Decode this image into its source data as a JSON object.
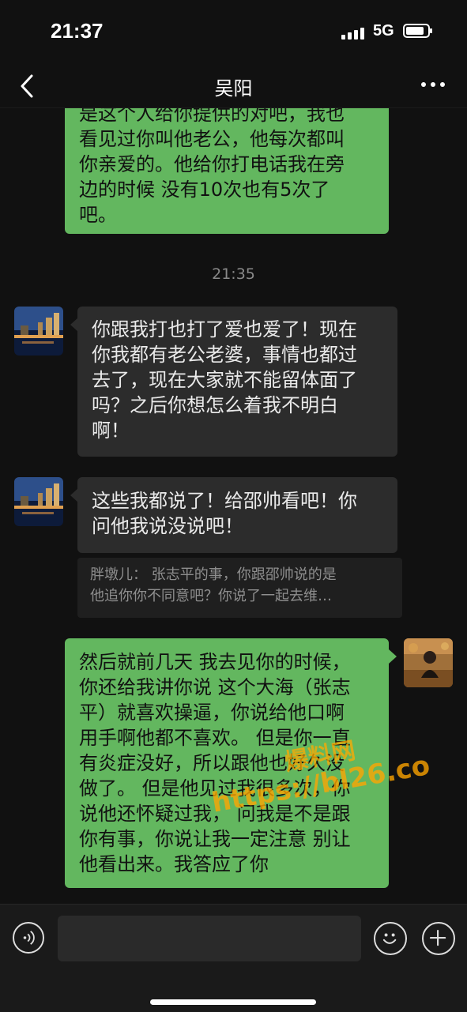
{
  "status_bar": {
    "time": "21:37",
    "network": "5G",
    "icons": [
      "signal-icon",
      "battery-icon"
    ]
  },
  "nav": {
    "title": "吴阳",
    "icons": [
      "back-chevron-icon",
      "more-icon"
    ]
  },
  "messages": [
    {
      "side": "right",
      "lines": [
        "是这个人给你提供的对吧，我也",
        "看见过你叫他老公，他每次都叫",
        "你亲爱的。他给你打电话我在旁",
        "边的时候 没有10次也有5次了",
        "吧。"
      ]
    },
    {
      "timestamp": "21:35"
    },
    {
      "side": "left",
      "lines": [
        "你跟我打也打了爱也爱了！现在",
        "你我都有老公老婆，事情也都过",
        "去了，现在大家就不能留体面了",
        "吗？之后你想怎么着我不明白",
        "啊！"
      ]
    },
    {
      "side": "left",
      "lines": [
        "这些我都说了！给邵帅看吧！你",
        "问他我说没说吧！"
      ],
      "quote": [
        "胖墩儿： 张志平的事，你跟邵帅说的是",
        "他追你你不同意吧？你说了一起去维…"
      ]
    },
    {
      "side": "right",
      "lines": [
        "然后就前几天 我去见你的时候，",
        "你还给我讲你说 这个大海（张志",
        "平）就喜欢操逼，你说给他口啊",
        "用手啊他都不喜欢。 但是你一直",
        "有炎症没好，所以跟他也好久没",
        "做了。 但是他见过我很多次，你",
        "说他还怀疑过我， 问我是不是跟",
        "你有事，你说让我一定注意 别让",
        "他看出来。我答应了你"
      ]
    }
  ],
  "watermark": {
    "line1": "爆料网",
    "line2": "https://bl26.co"
  },
  "input_bar": {
    "placeholder": "",
    "icons": [
      "voice-icon",
      "emoji-icon",
      "plus-icon"
    ]
  },
  "colors": {
    "sent_bubble": "#63b75f",
    "received_bubble": "#2c2c2c",
    "background": "#111111",
    "watermark": "#ffa500"
  }
}
